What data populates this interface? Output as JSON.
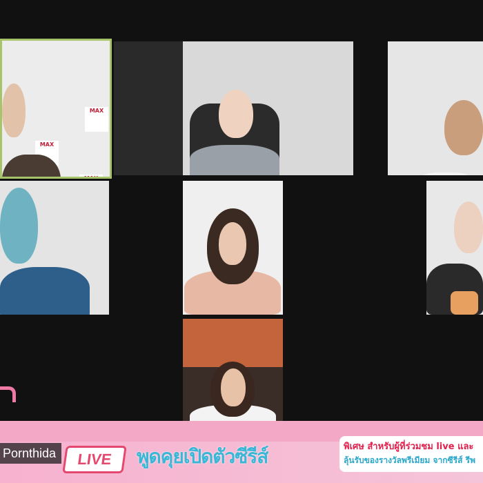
{
  "participants": [
    {
      "id": "p1",
      "active": true
    },
    {
      "id": "p2",
      "active": false
    },
    {
      "id": "p3",
      "active": false
    },
    {
      "id": "p4",
      "active": false
    },
    {
      "id": "p5",
      "active": false
    },
    {
      "id": "p6",
      "active": false
    },
    {
      "id": "p7",
      "active": false
    }
  ],
  "name_label": "Pornthida",
  "banner": {
    "live": "LIVE",
    "headline": "พูดคุยเปิดตัวซีรีส์",
    "promo_line1": "พิเศษ สำหรับผู้ที่ร่วมชม live และ",
    "promo_line2": "ลุ้นรับของรางวัลพรีเมียม จากซีรีส์ รีพ"
  },
  "logo_text": "MAX",
  "colors": {
    "active_border": "#a8c46a",
    "banner_pink": "#f3a9c6",
    "live_red": "#e4486e",
    "headline_blue": "#3ab6d6"
  }
}
